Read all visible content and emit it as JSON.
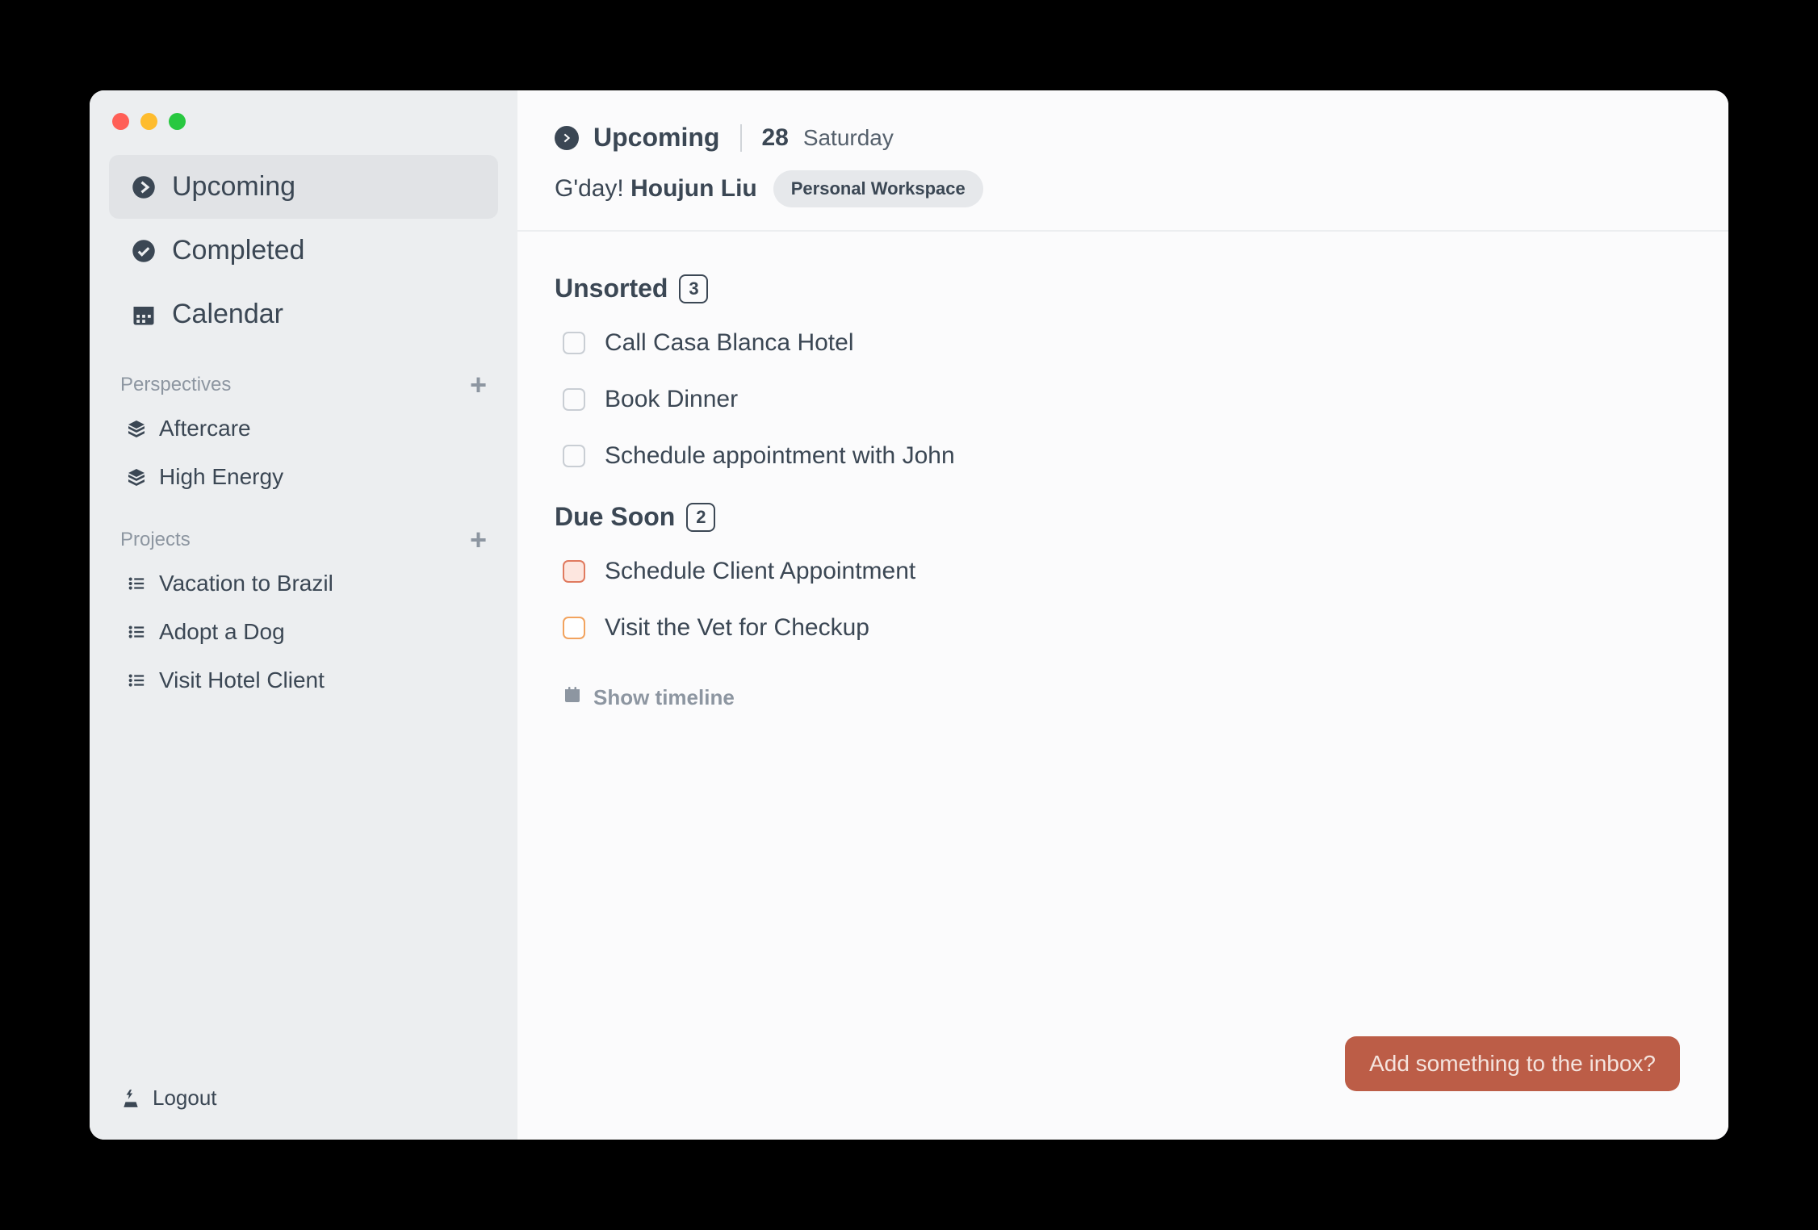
{
  "window": {
    "traffic": true
  },
  "sidebar": {
    "nav": [
      {
        "id": "upcoming",
        "label": "Upcoming",
        "icon": "chevron-circle",
        "active": true
      },
      {
        "id": "completed",
        "label": "Completed",
        "icon": "check-circle",
        "active": false
      },
      {
        "id": "calendar",
        "label": "Calendar",
        "icon": "calendar",
        "active": false
      }
    ],
    "perspectives_label": "Perspectives",
    "perspectives": [
      {
        "label": "Aftercare"
      },
      {
        "label": "High Energy"
      }
    ],
    "projects_label": "Projects",
    "projects": [
      {
        "label": "Vacation to Brazil"
      },
      {
        "label": "Adopt a Dog"
      },
      {
        "label": "Visit Hotel Client"
      }
    ],
    "logout_label": "Logout"
  },
  "header": {
    "title": "Upcoming",
    "day_num": "28",
    "day_name": "Saturday",
    "greeting_prefix": "G'day! ",
    "greeting_name": "Houjun Liu",
    "workspace": "Personal Workspace"
  },
  "groups": [
    {
      "title": "Unsorted",
      "count": "3",
      "tasks": [
        {
          "label": "Call Casa Blanca Hotel",
          "priority": "none"
        },
        {
          "label": "Book Dinner",
          "priority": "none"
        },
        {
          "label": "Schedule appointment with John",
          "priority": "none"
        }
      ]
    },
    {
      "title": "Due Soon",
      "count": "2",
      "tasks": [
        {
          "label": "Schedule Client Appointment",
          "priority": "red"
        },
        {
          "label": "Visit the Vet for Checkup",
          "priority": "orange"
        }
      ]
    }
  ],
  "timeline_label": "Show timeline",
  "inbox_button": "Add something to the inbox?"
}
